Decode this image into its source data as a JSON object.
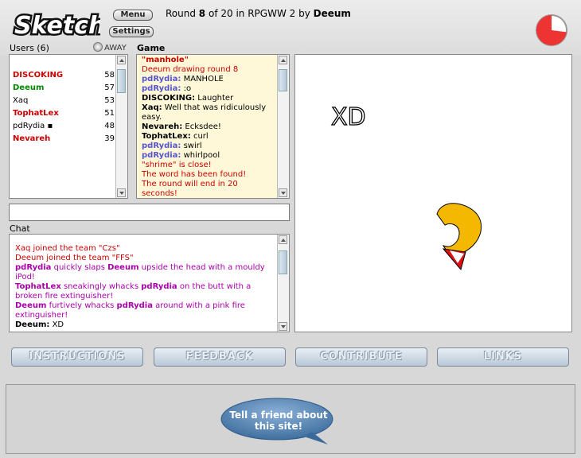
{
  "header": {
    "logo_text": "Sketch",
    "menu_label": "Menu",
    "settings_label": "Settings",
    "round_prefix": "Round",
    "round_current": "8",
    "round_of": "of 20 in RPGWW 2 by",
    "round_drawer": "Deeum",
    "timer_remaining_fraction": 0.27
  },
  "users": {
    "label": "Users (6)",
    "away_label": "AWAY",
    "list": [
      {
        "name": "DISCOKING",
        "score": "58",
        "color": "#cc0000",
        "bold": true
      },
      {
        "name": "Deeum",
        "score": "57",
        "color": "#008800",
        "bold": true
      },
      {
        "name": "Xaq",
        "score": "53",
        "color": "#000000",
        "bold": false
      },
      {
        "name": "TophatLex",
        "score": "51",
        "color": "#cc0000",
        "bold": true
      },
      {
        "name": "pdRydia ▪",
        "score": "48",
        "color": "#000000",
        "bold": false
      },
      {
        "name": "Nevareh",
        "score": "39",
        "color": "#cc0000",
        "bold": true
      }
    ]
  },
  "game": {
    "label": "Game",
    "messages": [
      {
        "name": "",
        "text": "\"manhole\"",
        "color": "#cc0000",
        "bold": true
      },
      {
        "name": "",
        "text": "Deeum drawing round 8",
        "color": "#cc0000"
      },
      {
        "name": "pdRydia:",
        "name_color": "#5555cc",
        "text": " MANHOLE"
      },
      {
        "name": "pdRydia:",
        "name_color": "#5555cc",
        "text": " :o"
      },
      {
        "name": "DISCOKING:",
        "name_color": "#000000",
        "text": " Laughter"
      },
      {
        "name": "Xaq:",
        "name_color": "#000000",
        "text": " Well that was ridiculously easy."
      },
      {
        "name": "Nevareh:",
        "name_color": "#000000",
        "text": " Ecksdee!"
      },
      {
        "name": "TophatLex:",
        "name_color": "#000000",
        "text": " curl"
      },
      {
        "name": "pdRydia:",
        "name_color": "#5555cc",
        "text": " swirl"
      },
      {
        "name": "pdRydia:",
        "name_color": "#5555cc",
        "text": " whirlpool"
      },
      {
        "name": "",
        "text": "\"shrime\" is close!",
        "color": "#cc0000"
      },
      {
        "name": "",
        "text": "The word has been found!",
        "color": "#cc0000"
      },
      {
        "name": "",
        "text": "The round will end in 20 seconds!",
        "color": "#cc0000"
      }
    ]
  },
  "guess_input": {
    "value": "",
    "placeholder": ""
  },
  "chat": {
    "label": "Chat",
    "messages": [
      {
        "parts": [
          {
            "t": "Xaq joined the team \"Czs\"",
            "c": "#cc0000"
          }
        ]
      },
      {
        "parts": [
          {
            "t": "Deeum joined the team \"FFS\"",
            "c": "#cc0000"
          }
        ]
      },
      {
        "parts": [
          {
            "t": "pdRydia",
            "c": "#aa00aa",
            "b": true
          },
          {
            "t": " quickly slaps ",
            "c": "#aa00aa"
          },
          {
            "t": "Deeum",
            "c": "#aa00aa",
            "b": true
          },
          {
            "t": " upside the head with a mouldy iPod!",
            "c": "#aa00aa"
          }
        ]
      },
      {
        "parts": [
          {
            "t": "TophatLex",
            "c": "#aa00aa",
            "b": true
          },
          {
            "t": " sneakingly whacks ",
            "c": "#aa00aa"
          },
          {
            "t": "pdRydia",
            "c": "#aa00aa",
            "b": true
          },
          {
            "t": " on the butt with a broken fire extinguisher!",
            "c": "#aa00aa"
          }
        ]
      },
      {
        "parts": [
          {
            "t": "Deeum",
            "c": "#aa00aa",
            "b": true
          },
          {
            "t": " furtively whacks ",
            "c": "#aa00aa"
          },
          {
            "t": "pdRydia",
            "c": "#aa00aa",
            "b": true
          },
          {
            "t": " around with a pink fire extinguisher!",
            "c": "#aa00aa"
          }
        ]
      },
      {
        "parts": [
          {
            "t": "Deeum:",
            "c": "#000000",
            "b": true
          },
          {
            "t": " XD",
            "c": "#000000"
          }
        ]
      }
    ]
  },
  "canvas": {
    "scribble_text": "XD"
  },
  "nav": {
    "instructions": "INSTRUCTIONS",
    "feedback": "FEEDBACK",
    "contribute": "CONTRIBUTE",
    "links": "LINKS"
  },
  "footer": {
    "bubble_text": "Tell a friend about this site!"
  },
  "colors": {
    "timer_red": "#ee3333",
    "drawing_yellow": "#f5b800",
    "drawing_red": "#dd1111"
  }
}
